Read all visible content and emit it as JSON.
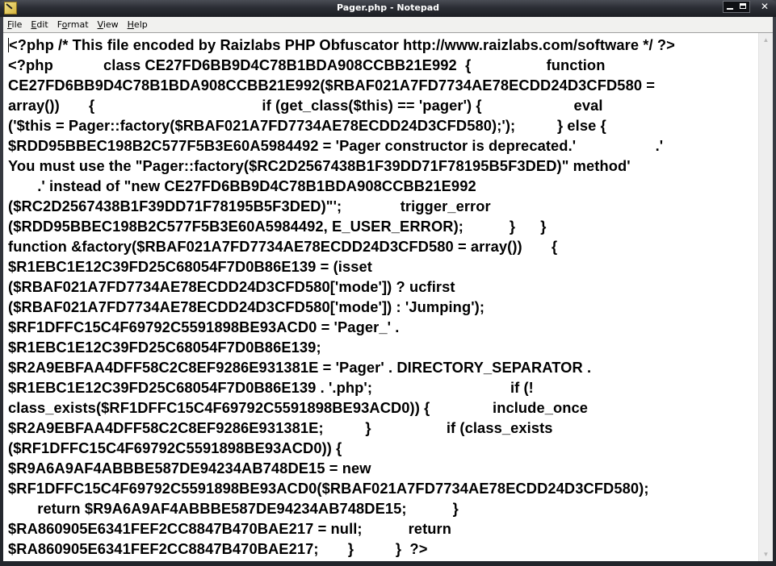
{
  "window": {
    "title": "Pager.php - Notepad",
    "controls": {
      "minimize": "minimize",
      "maximize": "maximize",
      "close": "✕"
    }
  },
  "menu": {
    "items": [
      {
        "accel": "F",
        "rest": "ile",
        "label": "File"
      },
      {
        "accel": "E",
        "rest": "dit",
        "label": "Edit"
      },
      {
        "accel": "",
        "rest": "Format",
        "label": "Format",
        "accel_index": 1
      },
      {
        "accel": "V",
        "rest": "iew",
        "label": "View"
      },
      {
        "accel": "H",
        "rest": "elp",
        "label": "Help"
      }
    ]
  },
  "editor": {
    "lines": [
      "<?php /* This file encoded by Raizlabs PHP Obfuscator http://www.raizlabs.com/software */ ?>",
      "<?php            class CE27FD6BB9D4C78B1BDA908CCBB21E992  {                  function",
      "CE27FD6BB9D4C78B1BDA908CCBB21E992($RBAF021A7FD7734AE78ECDD24D3CFD580 =",
      "array())       {                                        if (get_class($this) == 'pager') {                      eval",
      "('$this = Pager::factory($RBAF021A7FD7734AE78ECDD24D3CFD580);');          } else {",
      "$RDD95BBEC198B2C577F5B3E60A5984492 = 'Pager constructor is deprecated.'                   .'",
      "You must use the \"Pager::factory($RC2D2567438B1F39DD71F78195B5F3DED)\" method'",
      "       .' instead of \"new CE27FD6BB9D4C78B1BDA908CCBB21E992",
      "($RC2D2567438B1F39DD71F78195B5F3DED)\"';              trigger_error",
      "($RDD95BBEC198B2C577F5B3E60A5984492, E_USER_ERROR);           }      }",
      "function &factory($RBAF021A7FD7734AE78ECDD24D3CFD580 = array())       {",
      "$R1EBC1E12C39FD25C68054F7D0B86E139 = (isset",
      "($RBAF021A7FD7734AE78ECDD24D3CFD580['mode']) ? ucfirst",
      "($RBAF021A7FD7734AE78ECDD24D3CFD580['mode']) : 'Jumping');",
      "$RF1DFFC15C4F69792C5591898BE93ACD0 = 'Pager_' .",
      "$R1EBC1E12C39FD25C68054F7D0B86E139;",
      "$R2A9EBFAA4DFF58C2C8EF9286E931381E = 'Pager' . DIRECTORY_SEPARATOR .",
      "$R1EBC1E12C39FD25C68054F7D0B86E139 . '.php';                                 if (!",
      "class_exists($RF1DFFC15C4F69792C5591898BE93ACD0)) {               include_once",
      "$R2A9EBFAA4DFF58C2C8EF9286E931381E;          }                  if (class_exists",
      "($RF1DFFC15C4F69792C5591898BE93ACD0)) {",
      "$R9A6A9AF4ABBBE587DE94234AB748DE15 = new",
      "$RF1DFFC15C4F69792C5591898BE93ACD0($RBAF021A7FD7734AE78ECDD24D3CFD580);",
      "       return $R9A6A9AF4ABBBE587DE94234AB748DE15;           }",
      "$RA860905E6341FEF2CC8847B470BAE217 = null;           return",
      "$RA860905E6341FEF2CC8847B470BAE217;       }          }  ?>"
    ]
  },
  "scrollbar": {
    "up_arrow": "▲",
    "down_arrow": "▼"
  }
}
